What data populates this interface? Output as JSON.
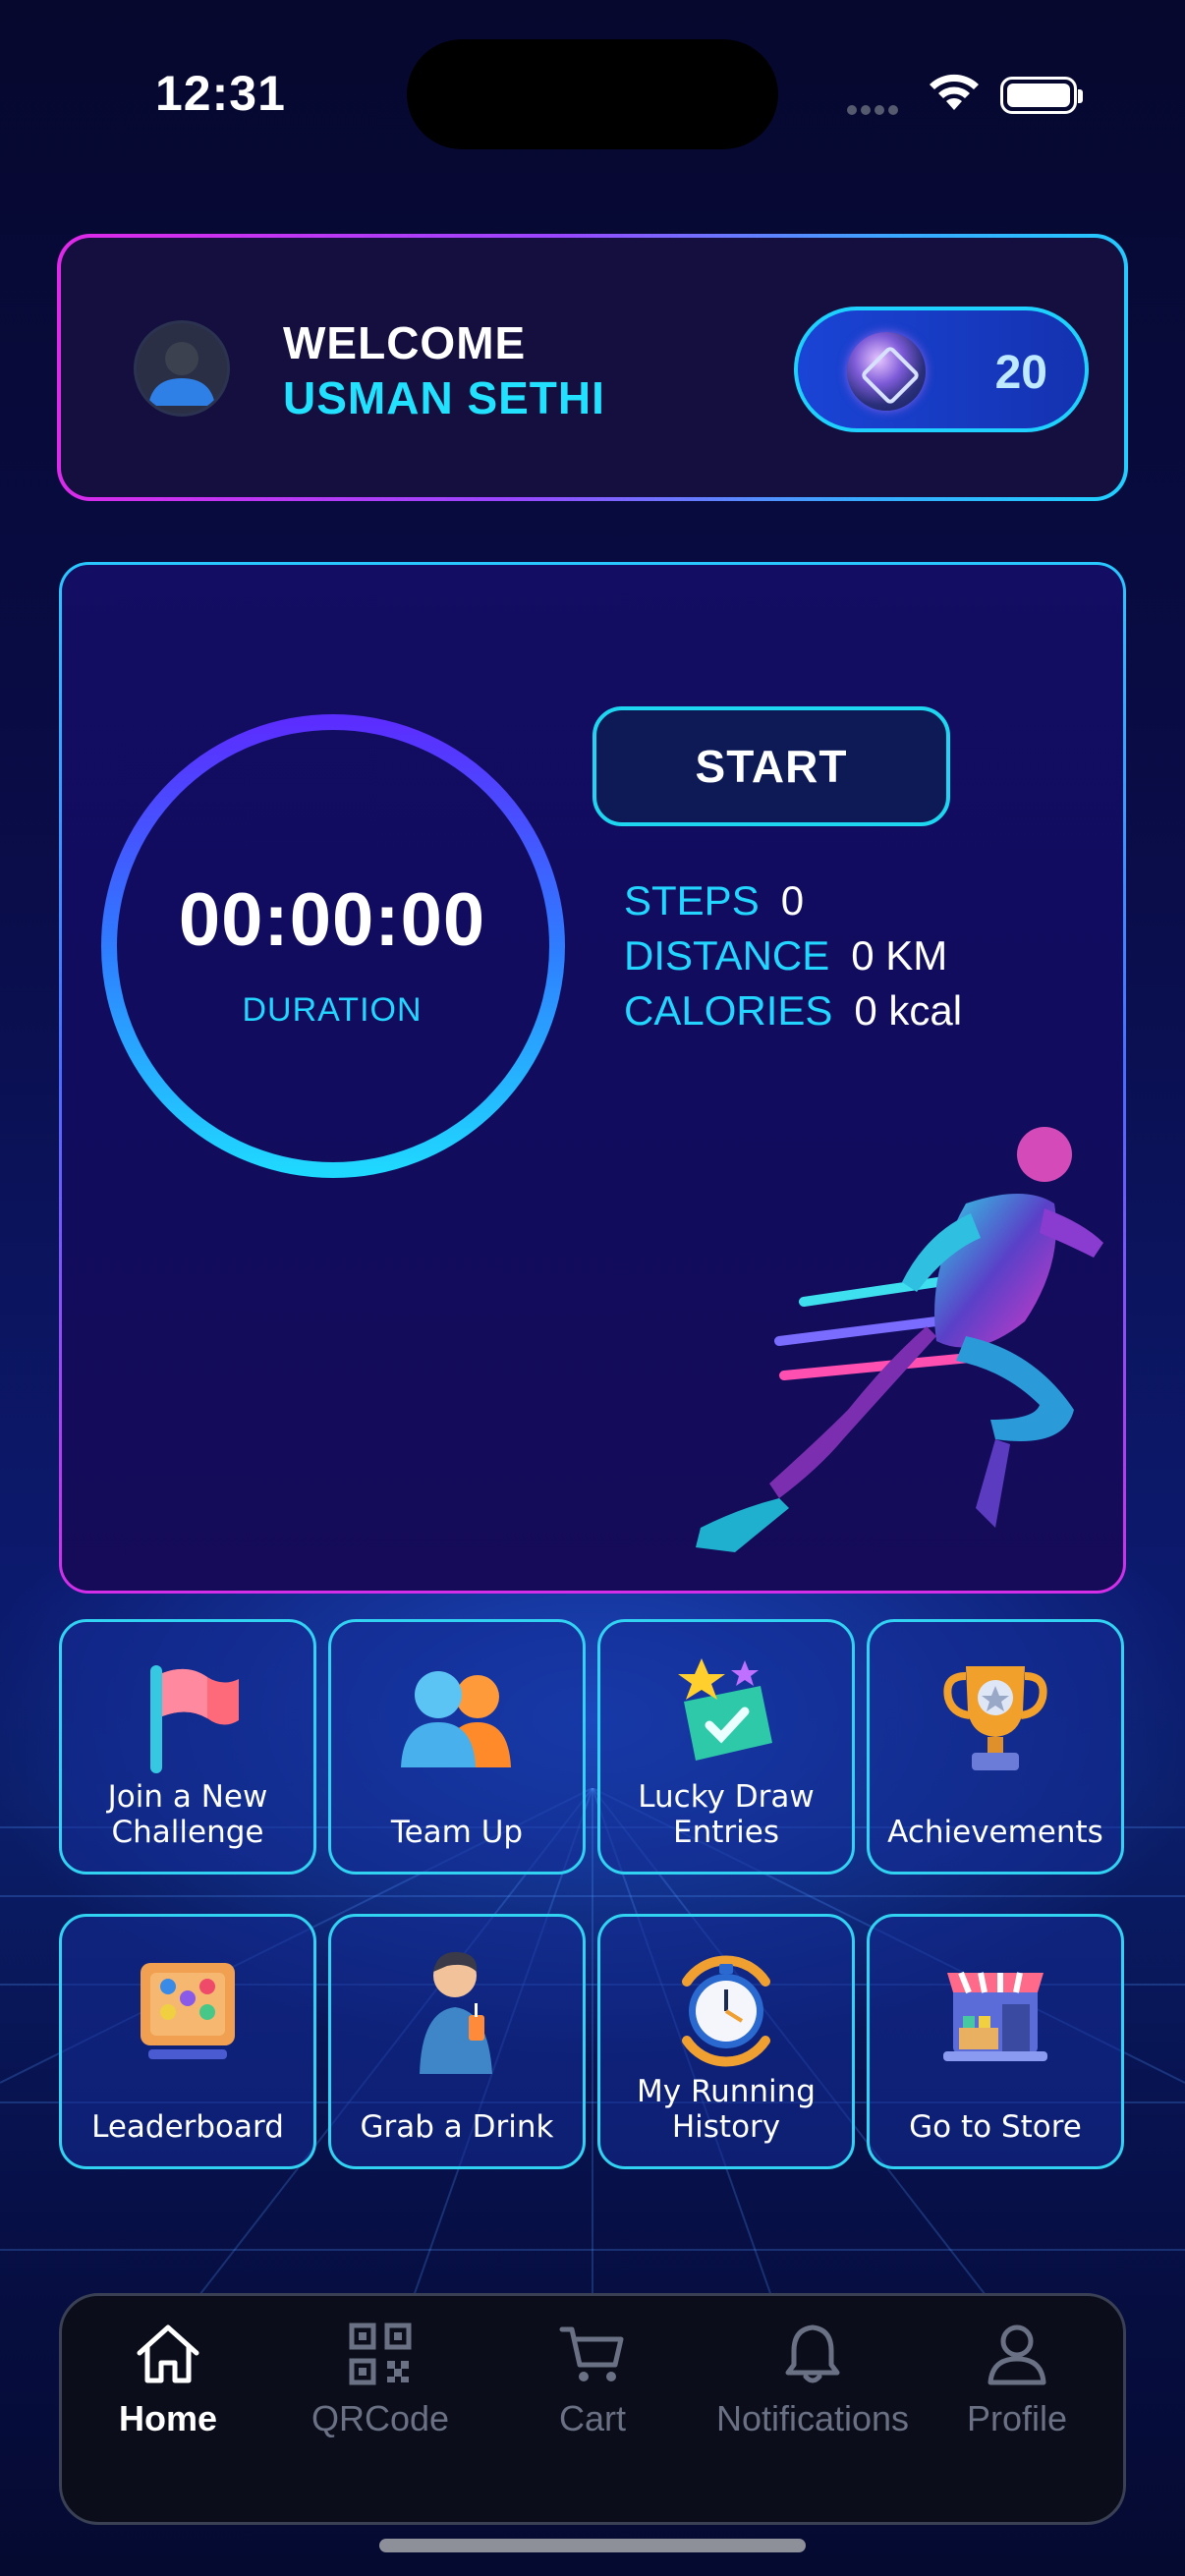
{
  "status_bar": {
    "time": "12:31"
  },
  "welcome": {
    "title": "WELCOME",
    "name": "USMAN SETHI",
    "coin_count": "20"
  },
  "tracker": {
    "duration_value": "00:00:00",
    "duration_label": "DURATION",
    "start_label": "START",
    "stats": [
      {
        "label": "STEPS",
        "value": "0"
      },
      {
        "label": "DISTANCE",
        "value": "0 KM"
      },
      {
        "label": "CALORIES",
        "value": "0 kcal"
      }
    ]
  },
  "tiles": [
    {
      "label": "Join a New Challenge",
      "icon": "flag-icon"
    },
    {
      "label": "Team Up",
      "icon": "team-icon"
    },
    {
      "label": "Lucky Draw Entries",
      "icon": "ticket-icon"
    },
    {
      "label": "Achievements",
      "icon": "trophy-icon"
    },
    {
      "label": "Leaderboard",
      "icon": "leaderboard-icon"
    },
    {
      "label": "Grab a Drink",
      "icon": "drink-person-icon"
    },
    {
      "label": "My Running History",
      "icon": "stopwatch-icon"
    },
    {
      "label": "Go to Store",
      "icon": "store-icon"
    }
  ],
  "tabbar": {
    "items": [
      {
        "label": "Home",
        "icon": "home-icon",
        "active": true
      },
      {
        "label": "QRCode",
        "icon": "qr-icon",
        "active": false
      },
      {
        "label": "Cart",
        "icon": "cart-icon",
        "active": false
      },
      {
        "label": "Notifications",
        "icon": "bell-icon",
        "active": false
      },
      {
        "label": "Profile",
        "icon": "person-icon",
        "active": false
      }
    ]
  },
  "colors": {
    "accent": "#22d6ff",
    "magenta": "#d42ee8",
    "background": "#07093a"
  }
}
